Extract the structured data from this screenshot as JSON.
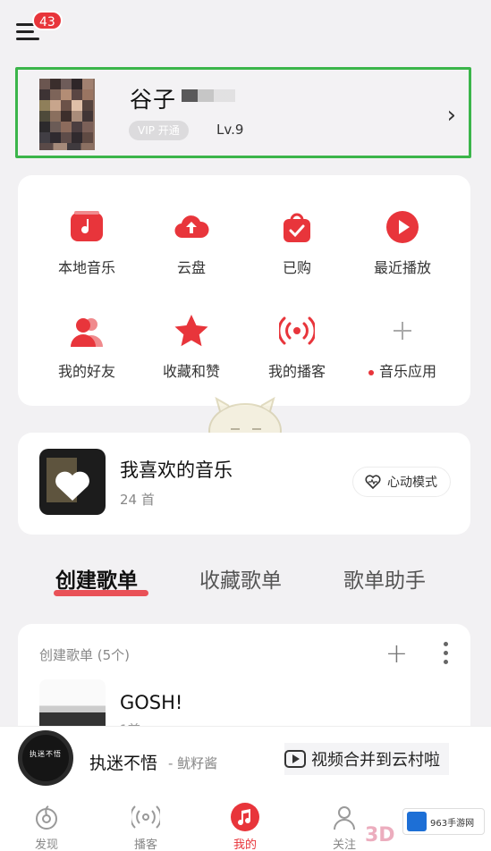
{
  "header": {
    "notification_count": "43"
  },
  "profile": {
    "name": "谷子",
    "vip_label": "VIP 开通",
    "level": "Lv.9"
  },
  "quick_grid": {
    "items": [
      {
        "label": "本地音乐",
        "icon": "local-music-icon"
      },
      {
        "label": "云盘",
        "icon": "cloud-upload-icon"
      },
      {
        "label": "已购",
        "icon": "purchased-bag-icon"
      },
      {
        "label": "最近播放",
        "icon": "recent-play-icon"
      },
      {
        "label": "我的好友",
        "icon": "friends-icon"
      },
      {
        "label": "收藏和赞",
        "icon": "star-icon"
      },
      {
        "label": "我的播客",
        "icon": "podcast-icon"
      },
      {
        "label": "音乐应用",
        "icon": "plus-icon"
      }
    ]
  },
  "favorite": {
    "title": "我喜欢的音乐",
    "count": "24 首",
    "heart_mode_label": "心动模式"
  },
  "tabs": [
    {
      "label": "创建歌单",
      "active": true
    },
    {
      "label": "收藏歌单",
      "active": false
    },
    {
      "label": "歌单助手",
      "active": false
    }
  ],
  "playlists": {
    "header": "创建歌单 (5个)",
    "items": [
      {
        "title": "GOSH!",
        "subtitle": "1首"
      }
    ]
  },
  "player": {
    "disc_text": "执迷不悟",
    "song": "执迷不悟",
    "artist": "- 鱿籽酱",
    "promo": "视频合并到云村啦"
  },
  "bottom_nav": [
    {
      "label": "发现",
      "active": false
    },
    {
      "label": "播客",
      "active": false
    },
    {
      "label": "我的",
      "active": true
    },
    {
      "label": "关注",
      "active": false
    }
  ],
  "watermark": {
    "text": "963手游网",
    "text3d": "3D"
  },
  "colors": {
    "accent": "#e8353b",
    "highlight_border": "#3bb54a"
  }
}
